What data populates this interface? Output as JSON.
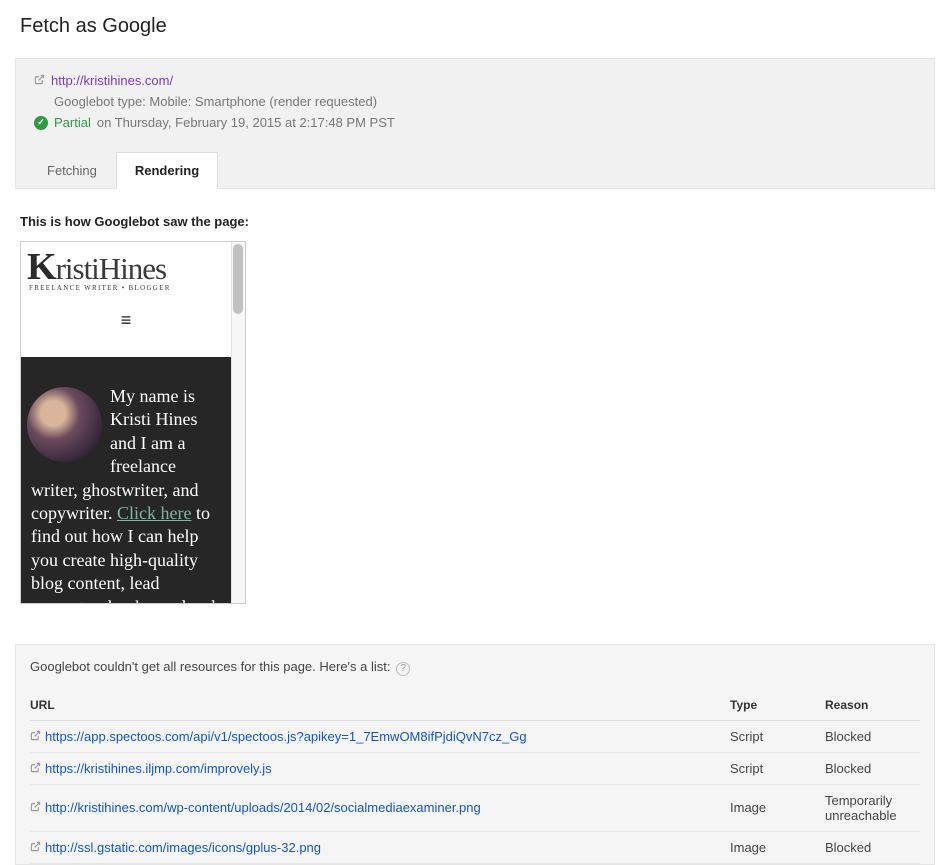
{
  "page_title": "Fetch as Google",
  "fetch": {
    "url": "http://kristihines.com/",
    "googlebot_info": "Googlebot type: Mobile: Smartphone (render requested)",
    "status_label": "Partial",
    "status_date": "on Thursday, February 19, 2015 at 2:17:48 PM PST"
  },
  "tabs": {
    "fetching": "Fetching",
    "rendering": "Rendering"
  },
  "render_heading": "This is how Googlebot saw the page:",
  "site": {
    "logo_main_prefix": "K",
    "logo_main_rest": "ristiHines",
    "logo_sub": "FREELANCE WRITER • BLOGGER",
    "menu_glyph": "≡",
    "hero_text_1": "My name is Kristi Hines and I am a freelance writer, ghostwriter, and copywriter. ",
    "hero_link": "Click here",
    "hero_text_2": " to find out how I can help you create high-quality blog content, lead magnets, ebooks, and web copy"
  },
  "resources": {
    "heading": "Googlebot couldn't get all resources for this page. Here's a list:",
    "columns": {
      "url": "URL",
      "type": "Type",
      "reason": "Reason"
    },
    "rows": [
      {
        "url": "https://app.spectoos.com/api/v1/spectoos.js?apikey=1_7EmwOM8ifPjdiQvN7cz_Gg",
        "type": "Script",
        "reason": "Blocked"
      },
      {
        "url": "https://kristihines.iljmp.com/improvely.js",
        "type": "Script",
        "reason": "Blocked"
      },
      {
        "url": "http://kristihines.com/wp-content/uploads/2014/02/socialmediaexaminer.png",
        "type": "Image",
        "reason": "Temporarily unreachable"
      },
      {
        "url": "http://ssl.gstatic.com/images/icons/gplus-32.png",
        "type": "Image",
        "reason": "Blocked"
      }
    ]
  }
}
